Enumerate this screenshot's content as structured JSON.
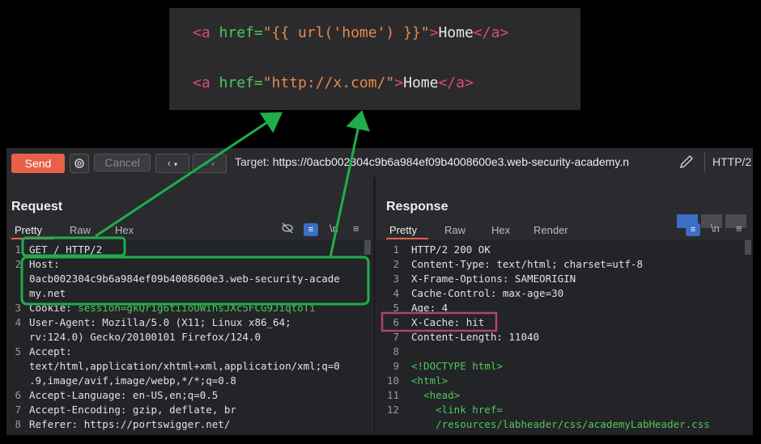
{
  "snippet": {
    "line1": {
      "open": "<a ",
      "attr": "href=",
      "value": "\"{{ url('home') }}\"",
      "close1": ">",
      "text": "Home",
      "close2": "</a>"
    },
    "line2": {
      "open": "<a ",
      "attr": "href=",
      "value": "\"http://x.com/\"",
      "close1": ">",
      "text": "Home",
      "close2": "</a>"
    }
  },
  "toolbar": {
    "send_label": "Send",
    "cancel_label": "Cancel",
    "target_prefix": "Target: ",
    "target_url": "https://0acb002304c9b6a984ef09b4008600e3.web-security-academy.n",
    "protocol": "HTTP/2",
    "accent": "#e8604a"
  },
  "request": {
    "title": "Request",
    "tabs": [
      "Pretty",
      "Raw",
      "Hex"
    ],
    "lines": [
      {
        "n": "1",
        "text": "GET / HTTP/2"
      },
      {
        "n": "2",
        "text": "Host:"
      },
      {
        "n": "",
        "text": "0acb002304c9b6a984ef09b4008600e3.web-security-acade"
      },
      {
        "n": "",
        "text": "my.net"
      },
      {
        "n": "3",
        "key": "Cookie: ",
        "val": "session=gkQrig6tiioUWihsJXc5FCG9JiqtoTi"
      },
      {
        "n": "4",
        "text": "User-Agent: Mozilla/5.0 (X11; Linux x86_64;"
      },
      {
        "n": "",
        "text": "rv:124.0) Gecko/20100101 Firefox/124.0"
      },
      {
        "n": "5",
        "text": "Accept:"
      },
      {
        "n": "",
        "text": "text/html,application/xhtml+xml,application/xml;q=0"
      },
      {
        "n": "",
        "text": ".9,image/avif,image/webp,*/*;q=0.8"
      },
      {
        "n": "6",
        "text": "Accept-Language: en-US,en;q=0.5"
      },
      {
        "n": "7",
        "text": "Accept-Encoding: gzip, deflate, br"
      },
      {
        "n": "8",
        "text": "Referer: https://portswigger.net/"
      }
    ]
  },
  "response": {
    "title": "Response",
    "tabs": [
      "Pretty",
      "Raw",
      "Hex",
      "Render"
    ],
    "lines": [
      {
        "n": "1",
        "text": "HTTP/2 200 OK"
      },
      {
        "n": "2",
        "text": "Content-Type: text/html; charset=utf-8"
      },
      {
        "n": "3",
        "text": "X-Frame-Options: SAMEORIGIN"
      },
      {
        "n": "4",
        "text": "Cache-Control: max-age=30"
      },
      {
        "n": "5",
        "text": "Age: 4"
      },
      {
        "n": "6",
        "text": "X-Cache: hit"
      },
      {
        "n": "7",
        "text": "Content-Length: 11040"
      },
      {
        "n": "8",
        "text": ""
      },
      {
        "n": "9",
        "text": "<!DOCTYPE html>"
      },
      {
        "n": "10",
        "text": "<html>"
      },
      {
        "n": "11",
        "text": "  <head>"
      },
      {
        "n": "12",
        "text": "    <link href="
      },
      {
        "n": "",
        "text": "    /resources/labheader/css/academyLabHeader.css"
      }
    ]
  },
  "annotations": {
    "green": "#1fae4a",
    "magenta": "#b0407a"
  }
}
